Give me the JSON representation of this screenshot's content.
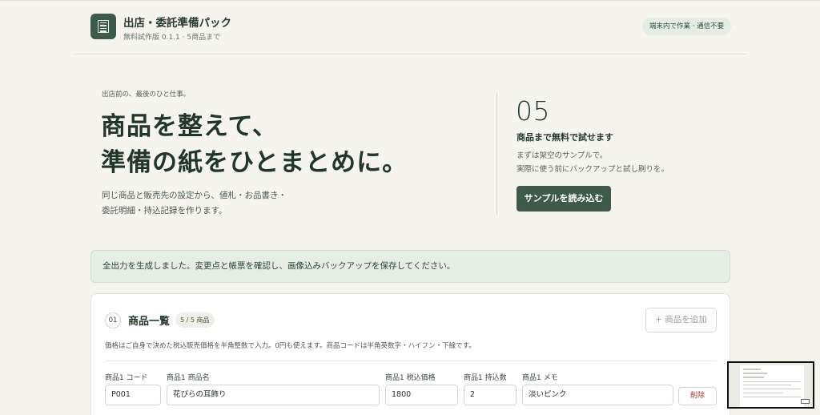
{
  "header": {
    "title": "出店・委託準備パック",
    "subtitle": "無料試作版 0.1.1 · 5商品まで",
    "status_pill": "端末内で作業 · 通信不要",
    "logo_icon": "document-list-icon"
  },
  "hero": {
    "eyebrow": "出店前の、最後のひと仕事。",
    "title_line1": "商品を整えて、",
    "title_line2": "準備の紙をひとまとめに。",
    "desc_line1": "同じ商品と販売先の設定から、値札・お品書き・",
    "desc_line2": "委託明細・持込記録を作ります。",
    "big_number": "05",
    "number_label": "商品まで無料で試せます",
    "number_desc_line1": "まずは架空のサンプルで。",
    "number_desc_line2": "実際に使う前にバックアップと試し刷りを。",
    "sample_button": "サンプルを読み込む"
  },
  "notice": {
    "text": "全出力を生成しました。変更点と帳票を確認し、画像込みバックアップを保存してください。"
  },
  "products": {
    "step": "01",
    "title": "商品一覧",
    "count": "5 / 5 商品",
    "add_button": "+ 商品を追加",
    "description": "価格はご自身で決めた税込販売価格を半角整数で入力。0円も使えます。商品コードは半角英数字・ハイフン・下線です。",
    "labels": {
      "code": "商品1 コード",
      "name": "商品1 商品名",
      "price": "商品1 税込価格",
      "qty": "商品1 持込数",
      "memo": "商品1 メモ"
    },
    "row1": {
      "code": "P001",
      "name": "花びらの耳飾り",
      "price": "1800",
      "qty": "2",
      "memo": "淡いピンク"
    },
    "delete_button": "削除"
  },
  "colors": {
    "accent": "#3d5a4b",
    "background": "#f5f4ef",
    "notice_bg": "#e6eee4",
    "danger": "#9d3b32"
  }
}
